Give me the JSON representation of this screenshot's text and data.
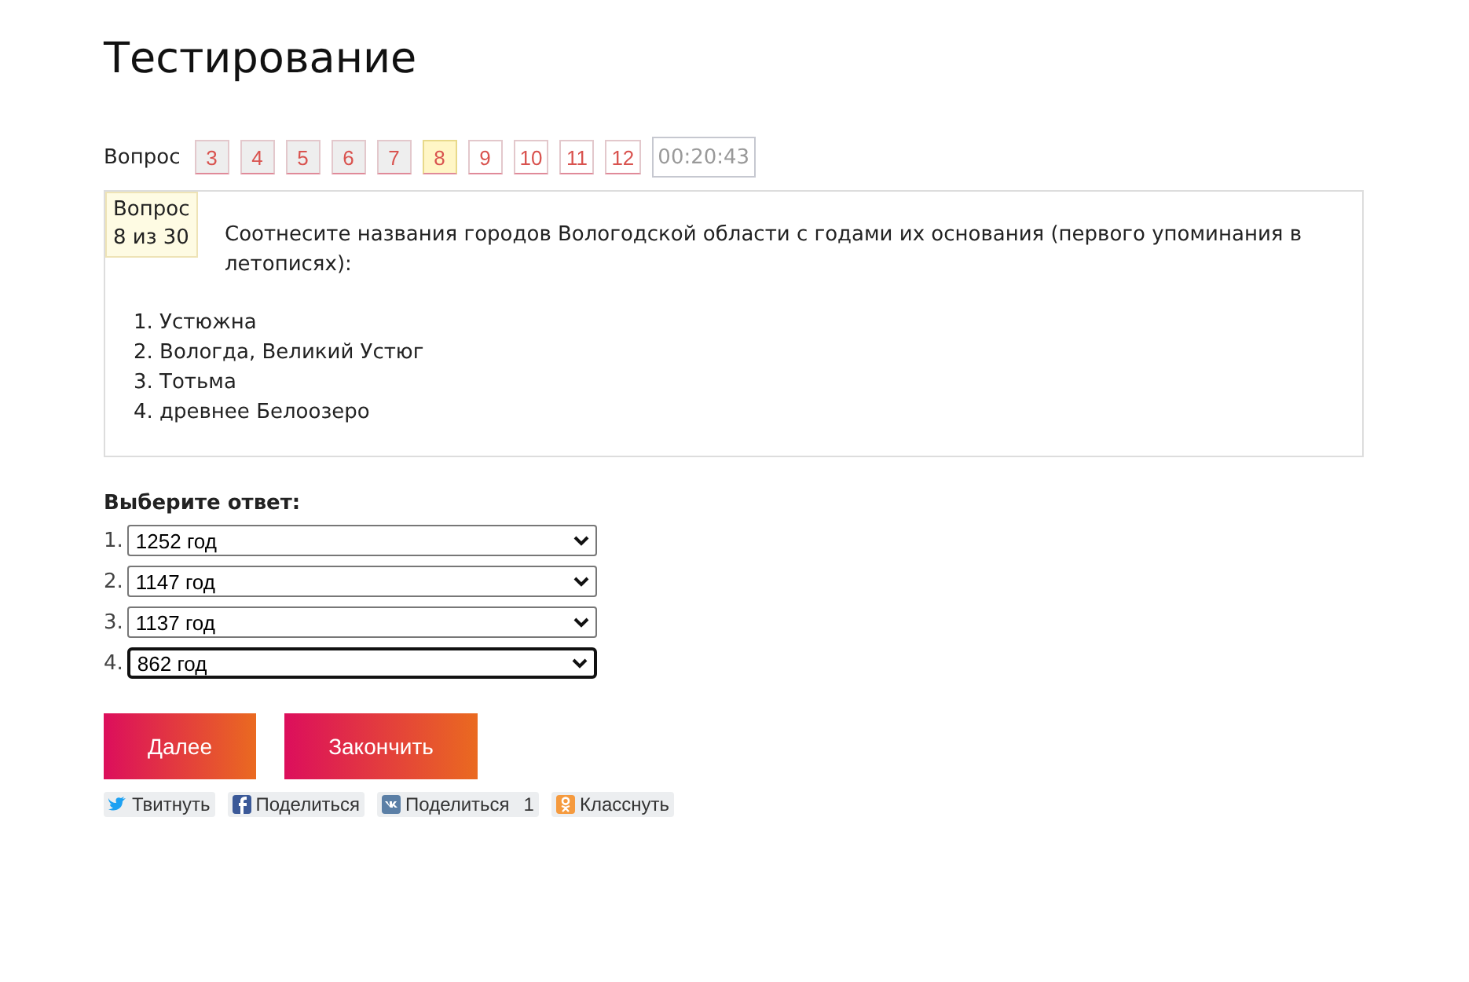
{
  "title": "Тестирование",
  "nav": {
    "label": "Вопрос",
    "questions": [
      {
        "number": "3",
        "answered": true,
        "selected": false
      },
      {
        "number": "4",
        "answered": true,
        "selected": false
      },
      {
        "number": "5",
        "answered": true,
        "selected": false
      },
      {
        "number": "6",
        "answered": true,
        "selected": false
      },
      {
        "number": "7",
        "answered": true,
        "selected": false
      },
      {
        "number": "8",
        "answered": false,
        "selected": true
      },
      {
        "number": "9",
        "answered": false,
        "selected": false
      },
      {
        "number": "10",
        "answered": false,
        "selected": false
      },
      {
        "number": "11",
        "answered": false,
        "selected": false
      },
      {
        "number": "12",
        "answered": false,
        "selected": false
      }
    ],
    "timer": "00:20:43"
  },
  "question": {
    "badge_line_1": "Вопрос",
    "badge_line_2": "8 из 30",
    "text": "Соотнесите названия городов Вологодской области с годами их основания (первого упоминания в летописях):",
    "items": [
      "1. Устюжна",
      "2. Вологда, Великий Устюг",
      "3. Тотьма",
      "4. древнее Белоозеро"
    ]
  },
  "answer": {
    "label": "Выберите ответ:",
    "selects": [
      {
        "number": "1.",
        "value": "1252 год",
        "focused": false
      },
      {
        "number": "2.",
        "value": "1147 год",
        "focused": false
      },
      {
        "number": "3.",
        "value": "1137 год",
        "focused": false
      },
      {
        "number": "4.",
        "value": "862 год",
        "focused": true
      }
    ]
  },
  "buttons": [
    "Далее",
    "Закончить"
  ],
  "share": [
    {
      "kind": "twitter",
      "label": "Твитнуть"
    },
    {
      "kind": "facebook",
      "label": "Поделиться"
    },
    {
      "kind": "vk",
      "label": "Поделиться",
      "count": "1"
    },
    {
      "kind": "ok",
      "label": "Класснуть"
    }
  ]
}
